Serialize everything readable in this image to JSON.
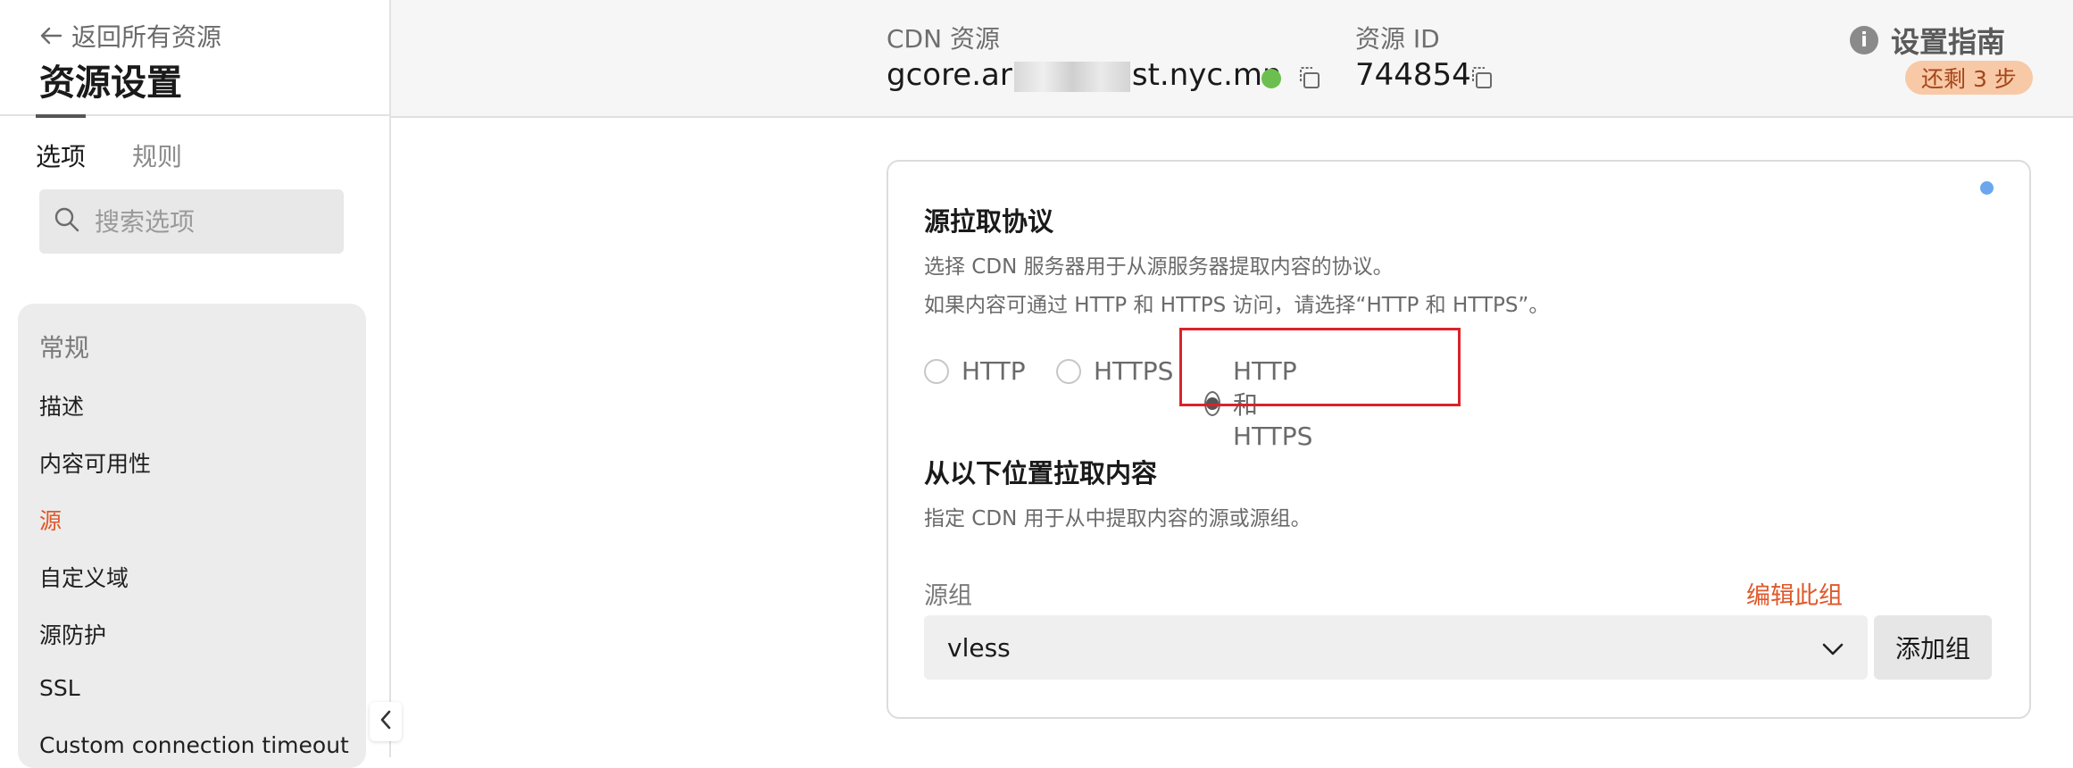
{
  "sidebar": {
    "back_label": "返回所有资源",
    "title": "资源设置",
    "tabs": [
      {
        "label": "选项",
        "active": true
      },
      {
        "label": "规则",
        "active": false
      }
    ],
    "search_placeholder": "搜索选项",
    "group_label": "常规",
    "items": [
      {
        "label": "描述",
        "active": false
      },
      {
        "label": "内容可用性",
        "active": false
      },
      {
        "label": "源",
        "active": true
      },
      {
        "label": "自定义域",
        "active": false
      },
      {
        "label": "源防护",
        "active": false
      },
      {
        "label": "SSL",
        "active": false
      },
      {
        "label": "Custom connection timeout",
        "active": false
      }
    ]
  },
  "header": {
    "cdn_label": "CDN 资源",
    "cdn_value_prefix": "gcore.ar",
    "cdn_value_suffix": "st.nyc.mn",
    "cdn_status_color": "#6bbf4e",
    "resource_id_label": "资源 ID",
    "resource_id_value": "744854",
    "guide_label": "设置指南",
    "steps_badge": "还剩 3 步"
  },
  "card": {
    "protocol_title": "源拉取协议",
    "protocol_desc_1": "选择 CDN 服务器用于从源服务器提取内容的协议。",
    "protocol_desc_2": "如果内容可通过 HTTP 和 HTTPS 访问，请选择“HTTP 和 HTTPS”。",
    "options": [
      {
        "label": "HTTP",
        "selected": false
      },
      {
        "label": "HTTPS",
        "selected": false
      },
      {
        "label": "HTTP 和 HTTPS",
        "selected": true
      }
    ],
    "pull_title": "从以下位置拉取内容",
    "pull_desc": "指定 CDN 用于从中提取内容的源或源组。",
    "origin_group_label": "源组",
    "edit_group_link": "编辑此组",
    "origin_group_value": "vless",
    "add_group_button": "添加组"
  },
  "colors": {
    "accent": "#e0582a",
    "highlight_border": "#d9232a",
    "badge_bg": "#f8c9a6"
  }
}
